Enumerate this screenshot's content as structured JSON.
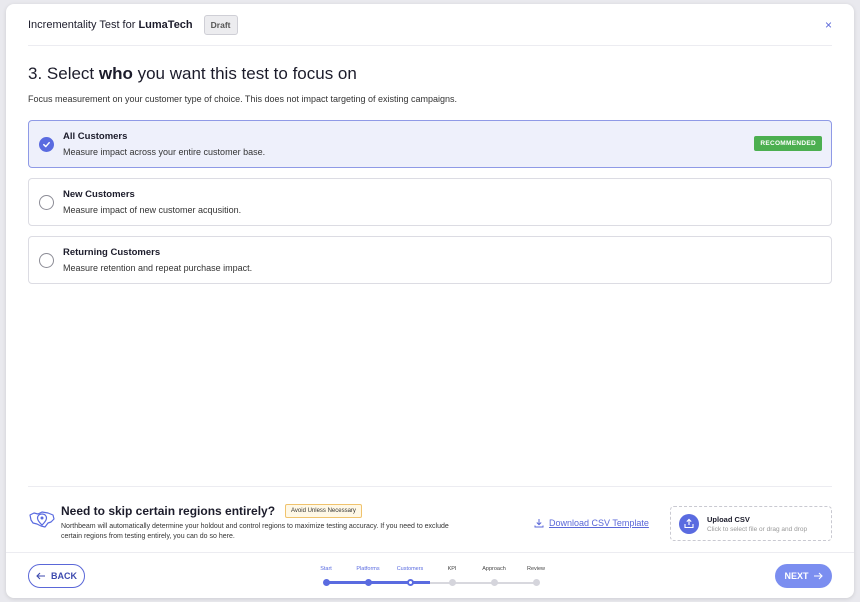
{
  "header": {
    "title_prefix": "Incrementality Test for ",
    "title_brand": "LumaTech",
    "status_badge": "Draft",
    "close_glyph": "×"
  },
  "step_heading": {
    "prefix": "3. Select ",
    "emphasis": "who",
    "suffix": " you want this test to focus on"
  },
  "subtitle": "Focus measurement on your customer type of choice. This does not impact targeting of existing campaigns.",
  "options": [
    {
      "title": "All Customers",
      "description": "Measure impact across your entire customer base.",
      "selected": true,
      "badge": "RECOMMENDED"
    },
    {
      "title": "New Customers",
      "description": "Measure impact of new customer acqusition.",
      "selected": false
    },
    {
      "title": "Returning Customers",
      "description": "Measure retention and repeat purchase impact.",
      "selected": false
    }
  ],
  "regions": {
    "icon": "map-pin-icon",
    "title": "Need to skip certain regions entirely?",
    "warning": "Avoid Unless Necessary",
    "description": "Northbeam will automatically determine your holdout and control regions to maximize testing accuracy. If you need to exclude certain regions from testing entirely, you can do so here.",
    "download_label": "Download CSV Template",
    "upload_title": "Upload CSV",
    "upload_sub": "Click to select file or drag and drop"
  },
  "footer": {
    "back_label": "BACK",
    "next_label": "NEXT",
    "steps": [
      {
        "label": "Start",
        "state": "done"
      },
      {
        "label": "Platforms",
        "state": "done"
      },
      {
        "label": "Customers",
        "state": "current"
      },
      {
        "label": "KPI",
        "state": "pending"
      },
      {
        "label": "Approach",
        "state": "pending"
      },
      {
        "label": "Review",
        "state": "pending"
      }
    ]
  },
  "colors": {
    "accent": "#5a6be0",
    "recommended": "#4caf50",
    "selected_bg": "#eef0fb",
    "warning_border": "#f0c36d"
  }
}
